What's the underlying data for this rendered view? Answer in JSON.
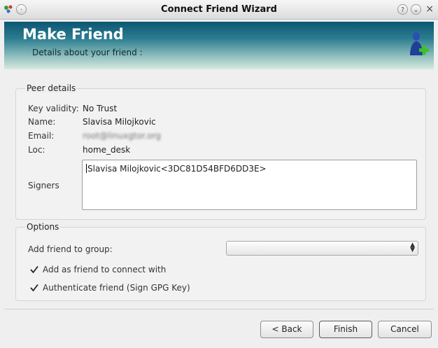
{
  "window": {
    "title": "Connect Friend Wizard",
    "help_glyph": "?",
    "minimize_glyph": "⌄",
    "close_glyph": "×"
  },
  "header": {
    "title": "Make Friend",
    "subtitle": "Details about your friend :",
    "icon": "add-user-icon"
  },
  "peer_details": {
    "group_label": "Peer details",
    "key_validity_label": "Key validity:",
    "key_validity_value": "No Trust",
    "name_label": "Name:",
    "name_value": "Slavisa Milojkovic",
    "email_label": "Email:",
    "email_value": "root@linuxgtor.org",
    "loc_label": "Loc:",
    "loc_value": "home_desk",
    "signers_label": "Signers",
    "signers_value": "Slavisa Milojkovic<3DC81D54BFD6DD3E>"
  },
  "options": {
    "group_label": "Options",
    "add_to_group_label": "Add friend to group:",
    "group_select_value": "",
    "add_as_friend_label": "Add as friend to connect with",
    "add_as_friend_checked": true,
    "authenticate_label": "Authenticate friend (Sign GPG Key)",
    "authenticate_checked": true
  },
  "buttons": {
    "back": "< Back",
    "finish": "Finish",
    "cancel": "Cancel"
  },
  "colors": {
    "banner_dark": "#0b5671",
    "banner_light": "#d8eadf",
    "accent_green": "#3fbf2a"
  }
}
